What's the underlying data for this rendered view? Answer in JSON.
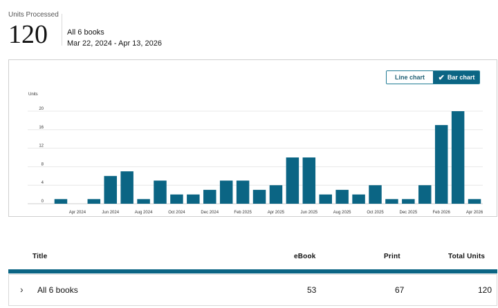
{
  "summary": {
    "caption": "Units Processed",
    "total": "120",
    "scope": "All 6 books",
    "date_range": "Mar 22, 2024 - Apr 13, 2026"
  },
  "toggle": {
    "line_label": "Line chart",
    "bar_label": "Bar chart",
    "selected": "Bar chart"
  },
  "chart_data": {
    "type": "bar",
    "ylabel": "Units",
    "ylim": [
      0,
      20
    ],
    "y_ticks": [
      "0",
      "4",
      "8",
      "12",
      "16",
      "20"
    ],
    "x_tick_labels": [
      "Apr 2024",
      "Jun 2024",
      "Aug 2024",
      "Oct 2024",
      "Dec 2024",
      "Feb 2025",
      "Apr 2025",
      "Jun 2025",
      "Aug 2025",
      "Oct 2025",
      "Dec 2025",
      "Feb 2026",
      "Apr 2026"
    ],
    "values": [
      1,
      0,
      1,
      6,
      7,
      1,
      5,
      2,
      2,
      3,
      5,
      5,
      3,
      4,
      10,
      10,
      2,
      3,
      2,
      4,
      1,
      1,
      4,
      17,
      20,
      1
    ],
    "bar_color": "#0b6584",
    "grid": true
  },
  "table": {
    "headers": {
      "title": "Title",
      "ebook": "eBook",
      "print": "Print",
      "total": "Total Units"
    },
    "rows": [
      {
        "title": "All 6 books",
        "ebook": "53",
        "print": "67",
        "total": "120"
      }
    ]
  }
}
